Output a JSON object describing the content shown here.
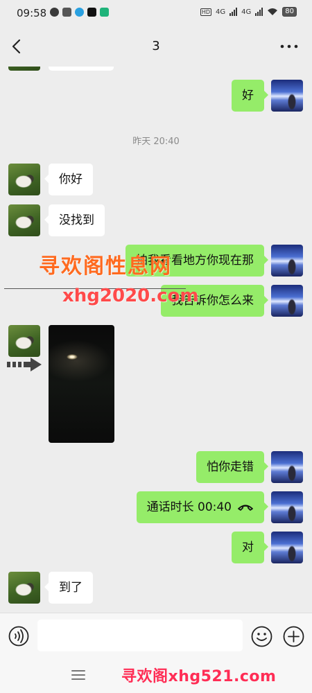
{
  "status_bar": {
    "time": "09:58",
    "network_1": "4G",
    "network_2": "4G",
    "hd_label": "HD",
    "battery": "80"
  },
  "header": {
    "title": "3"
  },
  "messages": [
    {
      "side": "right",
      "text": "好"
    },
    {
      "type": "timestamp",
      "text": "昨天 20:40"
    },
    {
      "side": "left",
      "text": "你好"
    },
    {
      "side": "left",
      "text": "没找到"
    },
    {
      "side": "right",
      "text": "拍我看看地方你现在那"
    },
    {
      "side": "right",
      "text": "我告诉你怎么来"
    },
    {
      "side": "left",
      "type": "video"
    },
    {
      "side": "right",
      "text": "怕你走错"
    },
    {
      "side": "right",
      "type": "call",
      "text": "通话时长 00:40"
    },
    {
      "side": "right",
      "text": "对"
    },
    {
      "side": "left",
      "text": "到了"
    }
  ],
  "watermarks": {
    "line1": "寻欢阁性息网",
    "line2": "xhg2020.com",
    "bottom": "寻欢阁xhg521.com"
  },
  "colors": {
    "background": "#ededed",
    "bubble_self": "#95ec69",
    "bubble_other": "#ffffff"
  },
  "icons": {
    "back": "chevron-left-icon",
    "more": "more-dots-icon",
    "voice": "voice-icon",
    "emoji": "emoji-icon",
    "plus": "plus-icon",
    "call": "phone-hangup-icon",
    "menu": "menu-icon"
  }
}
